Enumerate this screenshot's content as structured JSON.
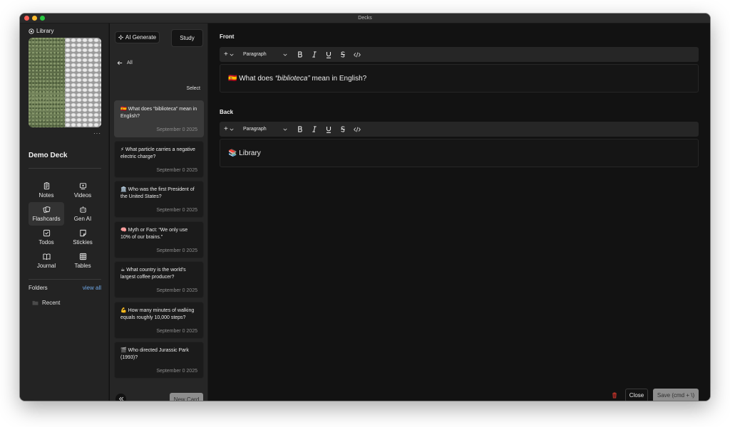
{
  "window": {
    "title": "Decks"
  },
  "sidebar": {
    "library_label": "Library",
    "more_label": "···",
    "deck_name": "Demo Deck",
    "nav": [
      {
        "label": "Notes",
        "icon": "notes-icon",
        "active": false
      },
      {
        "label": "Videos",
        "icon": "videos-icon",
        "active": false
      },
      {
        "label": "Flashcards",
        "icon": "flashcards-icon",
        "active": true
      },
      {
        "label": "Gen AI",
        "icon": "gen-ai-icon",
        "active": false
      },
      {
        "label": "Todos",
        "icon": "todos-icon",
        "active": false
      },
      {
        "label": "Stickies",
        "icon": "stickies-icon",
        "active": false
      },
      {
        "label": "Journal",
        "icon": "journal-icon",
        "active": false
      },
      {
        "label": "Tables",
        "icon": "tables-icon",
        "active": false
      }
    ],
    "folders_label": "Folders",
    "view_all_label": "view all",
    "recent_label": "Recent"
  },
  "cardlist": {
    "ai_generate_label": "AI Generate",
    "study_label": "Study",
    "back_label": "All",
    "select_label": "Select",
    "new_card_label": "New Card",
    "cards": [
      {
        "emoji": "🇪🇸",
        "question": "What does “biblioteca” mean in English?",
        "date": "September 0 2025"
      },
      {
        "emoji": "⚡",
        "question": "What particle carries a negative electric charge?",
        "date": "September 0 2025"
      },
      {
        "emoji": "🏛️",
        "question": "Who was the first President of the United States?",
        "date": "September 0 2025"
      },
      {
        "emoji": "🧠",
        "question": "Myth or Fact: “We only use 10% of our brains.”",
        "date": "September 0 2025"
      },
      {
        "emoji": "☕",
        "question": "What country is the world's largest coffee producer?",
        "date": "September 0 2025"
      },
      {
        "emoji": "💪",
        "question": "How many minutes of walking equals roughly 10,000 steps?",
        "date": "September 0 2025"
      },
      {
        "emoji": "🎬",
        "question": "Who directed Jurassic Park (1993)?",
        "date": "September 0 2025"
      }
    ]
  },
  "editor": {
    "front_label": "Front",
    "back_label": "Back",
    "paragraph_label": "Paragraph",
    "plus_label": "+",
    "front_emoji": "🇪🇸",
    "front_pre": "What does ",
    "front_em": "“biblioteca”",
    "front_post": " mean in English?",
    "back_emoji": "📚",
    "back_text": "Library",
    "close_label": "Close",
    "save_label": "Save (cmd + \\)"
  },
  "colors": {
    "accent_link": "#6fa7e6",
    "trash": "#c0392b"
  }
}
